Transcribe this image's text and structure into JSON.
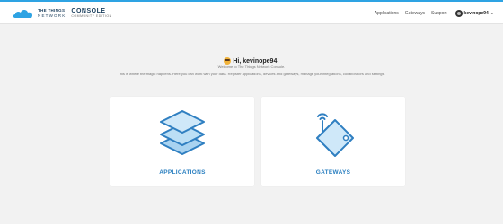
{
  "header": {
    "brand_line1": "THE THINGS",
    "brand_line2": "NETWORK",
    "console_title": "CONSOLE",
    "console_subtitle": "COMMUNITY EDITION",
    "nav": [
      {
        "label": "Applications"
      },
      {
        "label": "Gateways"
      },
      {
        "label": "Support"
      }
    ],
    "user": {
      "name": "kevinope94"
    }
  },
  "main": {
    "greeting": "Hi, kevinope94!",
    "welcome": "Welcome to The Things Network Console.",
    "description": "This is where the magic happens. Here you can work with your data. Register applications, devices and gateways, manage your integrations, collaborators and settings.",
    "cards": [
      {
        "label": "APPLICATIONS",
        "icon": "stacked-layers-icon"
      },
      {
        "label": "GATEWAYS",
        "icon": "gateway-device-icon"
      }
    ]
  },
  "colors": {
    "accent": "#2ea3e3",
    "brand_dark": "#1b3e5c",
    "card_label": "#2a7fc0",
    "background": "#f2f2f2"
  }
}
